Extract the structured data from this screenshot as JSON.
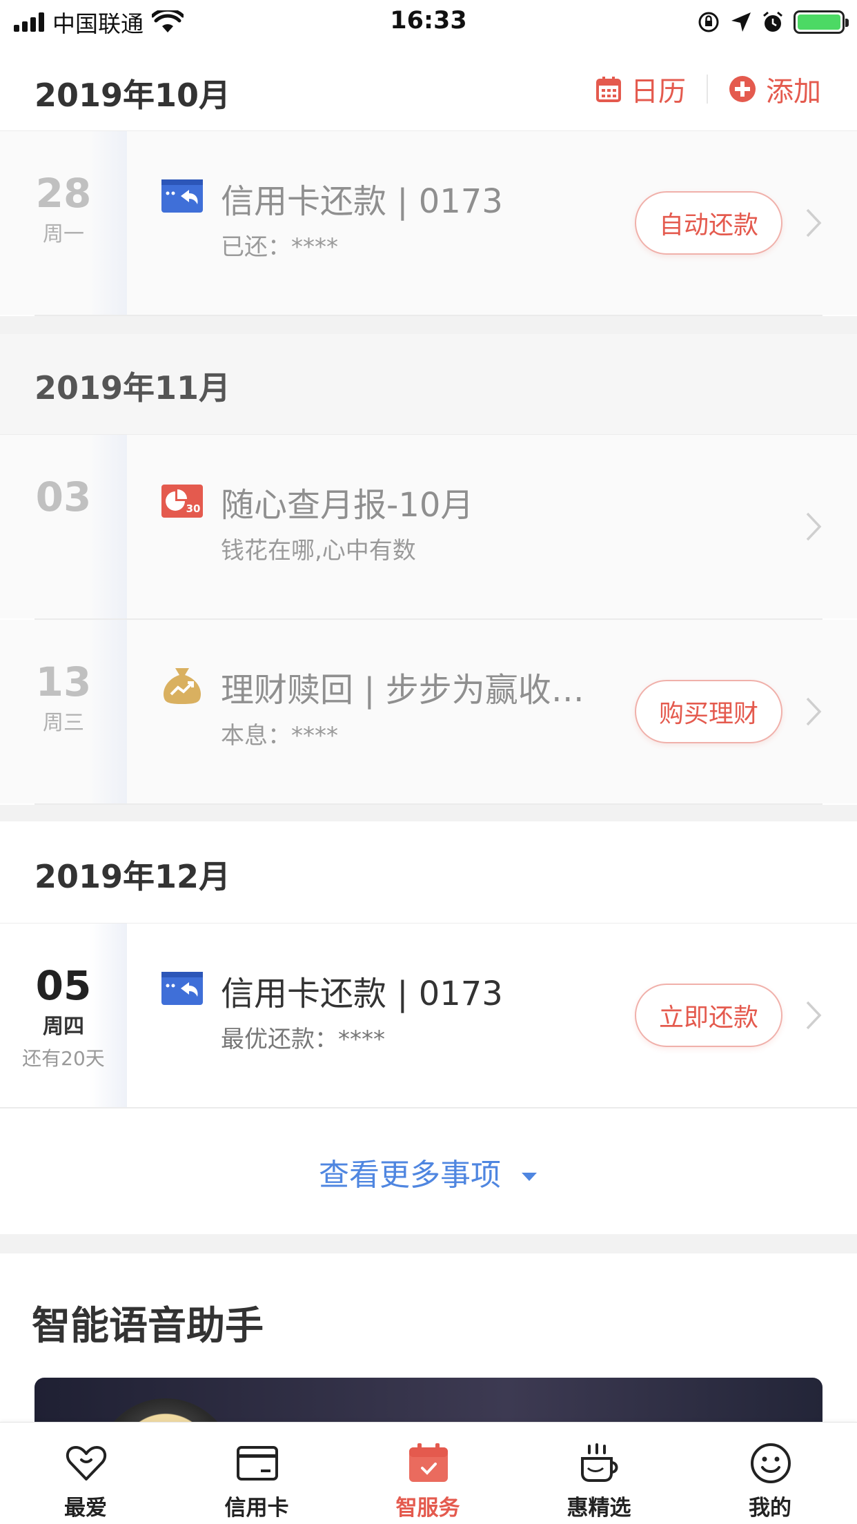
{
  "status_bar": {
    "carrier": "中国联通",
    "time": "16:33"
  },
  "header": {
    "calendar_label": "日历",
    "add_label": "添加",
    "accent_color": "#e45a4e"
  },
  "months": [
    {
      "title": "2019年10月",
      "items": [
        {
          "day": "28",
          "weekday": "周一",
          "icon": "credit-card-repay-icon",
          "title": "信用卡还款 | 0173",
          "subtitle": "已还：****",
          "button": "自动还款",
          "state": "past"
        }
      ]
    },
    {
      "title": "2019年11月",
      "items": [
        {
          "day": "03",
          "icon": "monthly-report-icon",
          "title": "随心查月报-10月",
          "subtitle": "钱花在哪,心中有数",
          "state": "past"
        },
        {
          "day": "13",
          "weekday": "周三",
          "icon": "money-bag-icon",
          "title": "理财赎回 | 步步为赢收…",
          "subtitle": "本息：****",
          "button": "购买理财",
          "state": "past"
        }
      ]
    },
    {
      "title": "2019年12月",
      "items": [
        {
          "day": "05",
          "weekday": "周四",
          "remaining": "还有20天",
          "icon": "credit-card-repay-icon",
          "title": "信用卡还款 | 0173",
          "subtitle": "最优还款：****",
          "button": "立即还款",
          "state": "upcoming"
        }
      ]
    }
  ],
  "more_link": "查看更多事项",
  "voice_section": {
    "title": "智能语音助手"
  },
  "tabbar": {
    "items": [
      {
        "label": "最爱",
        "icon": "heart-icon"
      },
      {
        "label": "信用卡",
        "icon": "card-icon"
      },
      {
        "label": "智服务",
        "icon": "calendar-check-icon",
        "active": true
      },
      {
        "label": "惠精选",
        "icon": "coffee-cup-icon"
      },
      {
        "label": "我的",
        "icon": "smiley-icon"
      }
    ]
  }
}
